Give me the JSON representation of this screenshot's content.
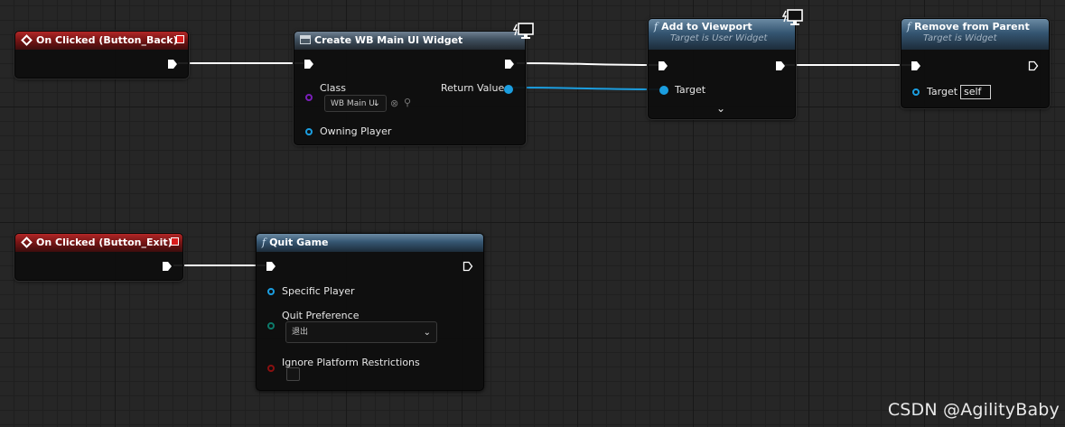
{
  "graph": {
    "nodes": {
      "on_clicked_back": {
        "title": "On Clicked (Button_Back)"
      },
      "create_widget": {
        "title": "Create WB Main UI Widget",
        "class_label": "Class",
        "class_value": "WB Main UI",
        "return_label": "Return Value",
        "owning_player_label": "Owning Player"
      },
      "add_to_viewport": {
        "title": "Add to Viewport",
        "subtitle": "Target is User Widget",
        "target_label": "Target"
      },
      "remove_from_parent": {
        "title": "Remove from Parent",
        "subtitle": "Target is Widget",
        "target_label": "Target",
        "target_value": "self"
      },
      "on_clicked_exit": {
        "title": "On Clicked (Button_Exit)"
      },
      "quit_game": {
        "title": "Quit Game",
        "specific_player_label": "Specific Player",
        "quit_pref_label": "Quit Preference",
        "quit_pref_value": "退出",
        "ignore_label": "Ignore Platform Restrictions"
      }
    },
    "function_glyph": "f"
  },
  "colors": {
    "event_header": "#9a1e1e",
    "function_header": "#355672",
    "object_pin": "#1b9ee0",
    "class_pin": "#7a1fb8",
    "enum_pin": "#0d7a6a",
    "bool_pin": "#8a1010",
    "exec_wire": "#ffffff",
    "object_wire": "#1b9ee0"
  },
  "watermark": "CSDN @AgilityBaby"
}
